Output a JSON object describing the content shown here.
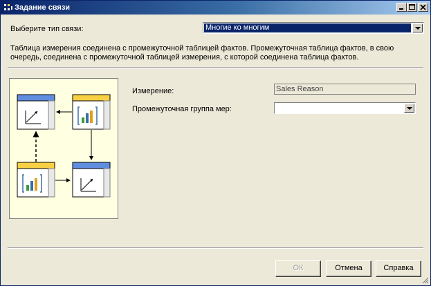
{
  "title": "Задание связи",
  "relationship_type": {
    "label": "Выберите тип связи:",
    "value": "Многие ко многим"
  },
  "description": "Таблица измерения соединена с промежуточной таблицей фактов. Промежуточная таблица фактов, в свою очередь, соединена с промежуточной таблицей измерения, с которой соединена таблица фактов.",
  "dimension": {
    "label": "Измерение:",
    "value": "Sales Reason"
  },
  "intermediate_group": {
    "label": "Промежуточная группа мер:",
    "value": ""
  },
  "buttons": {
    "ok": "ОК",
    "cancel": "Отмена",
    "help": "Справка"
  },
  "colors": {
    "titlebar_start": "#0a246a",
    "titlebar_end": "#a6caf0",
    "selection": "#0a246a",
    "diagram_bg": "#ffffe1",
    "dimension_header": "#5f8ee0",
    "fact_header": "#f8d043"
  }
}
